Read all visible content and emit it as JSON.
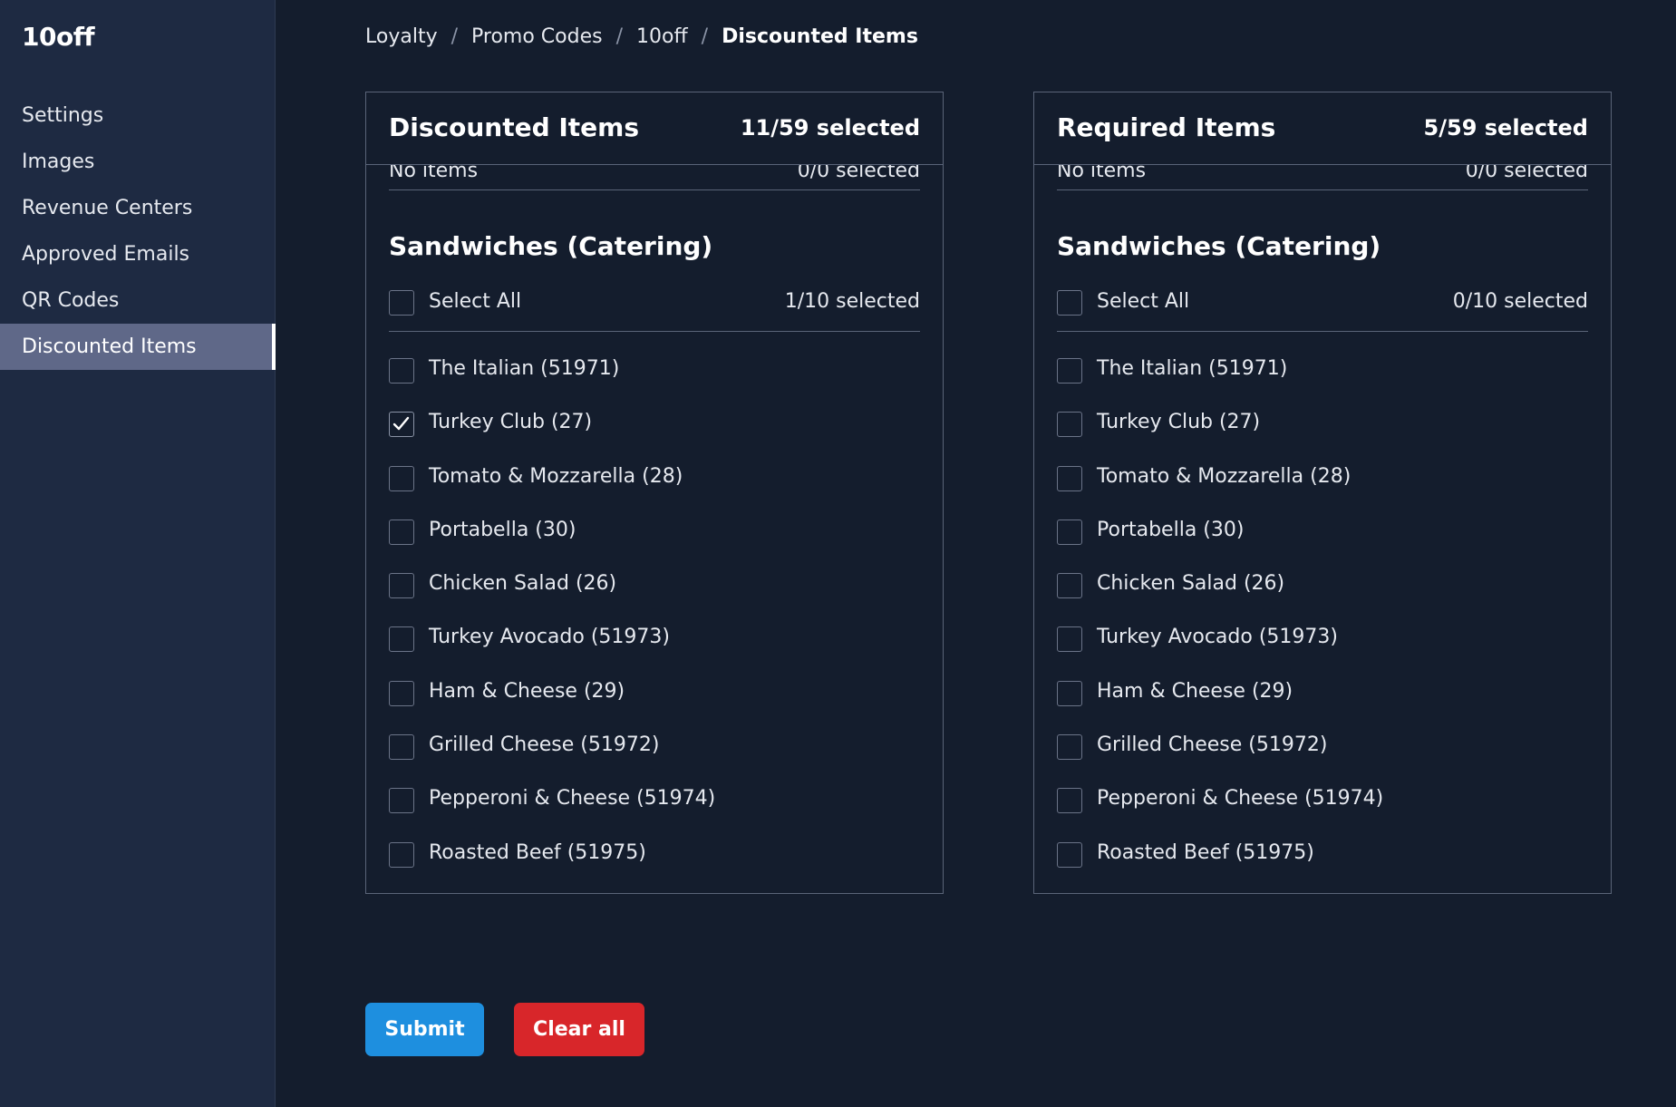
{
  "app": {
    "title": "10off"
  },
  "sidebar": {
    "items": [
      {
        "label": "Settings",
        "active": false
      },
      {
        "label": "Images",
        "active": false
      },
      {
        "label": "Revenue Centers",
        "active": false
      },
      {
        "label": "Approved Emails",
        "active": false
      },
      {
        "label": "QR Codes",
        "active": false
      },
      {
        "label": "Discounted Items",
        "active": true
      }
    ]
  },
  "breadcrumb": {
    "items": [
      "Loyalty",
      "Promo Codes",
      "10off",
      "Discounted Items"
    ],
    "separator": "/"
  },
  "panels": [
    {
      "title": "Discounted Items",
      "count": "11/59 selected",
      "partial_row": {
        "label": "No items",
        "count": "0/0 selected"
      },
      "category": {
        "title": "Sandwiches (Catering)",
        "select_all_label": "Select All",
        "select_all_count": "1/10 selected",
        "items": [
          {
            "label": "The Italian (51971)",
            "checked": false
          },
          {
            "label": "Turkey Club (27)",
            "checked": true
          },
          {
            "label": "Tomato & Mozzarella (28)",
            "checked": false
          },
          {
            "label": "Portabella (30)",
            "checked": false
          },
          {
            "label": "Chicken Salad (26)",
            "checked": false
          },
          {
            "label": "Turkey Avocado (51973)",
            "checked": false
          },
          {
            "label": "Ham & Cheese (29)",
            "checked": false
          },
          {
            "label": "Grilled Cheese (51972)",
            "checked": false
          },
          {
            "label": "Pepperoni & Cheese (51974)",
            "checked": false
          },
          {
            "label": "Roasted Beef (51975)",
            "checked": false
          }
        ]
      }
    },
    {
      "title": "Required Items",
      "count": "5/59 selected",
      "partial_row": {
        "label": "No items",
        "count": "0/0 selected"
      },
      "category": {
        "title": "Sandwiches (Catering)",
        "select_all_label": "Select All",
        "select_all_count": "0/10 selected",
        "items": [
          {
            "label": "The Italian (51971)",
            "checked": false
          },
          {
            "label": "Turkey Club (27)",
            "checked": false
          },
          {
            "label": "Tomato & Mozzarella (28)",
            "checked": false
          },
          {
            "label": "Portabella (30)",
            "checked": false
          },
          {
            "label": "Chicken Salad (26)",
            "checked": false
          },
          {
            "label": "Turkey Avocado (51973)",
            "checked": false
          },
          {
            "label": "Ham & Cheese (29)",
            "checked": false
          },
          {
            "label": "Grilled Cheese (51972)",
            "checked": false
          },
          {
            "label": "Pepperoni & Cheese (51974)",
            "checked": false
          },
          {
            "label": "Roasted Beef (51975)",
            "checked": false
          }
        ]
      }
    }
  ],
  "actions": {
    "submit_label": "Submit",
    "clear_label": "Clear all"
  },
  "colors": {
    "submit": "#1e8fdf",
    "clear": "#d8262a",
    "active_nav": "#5f6888"
  }
}
